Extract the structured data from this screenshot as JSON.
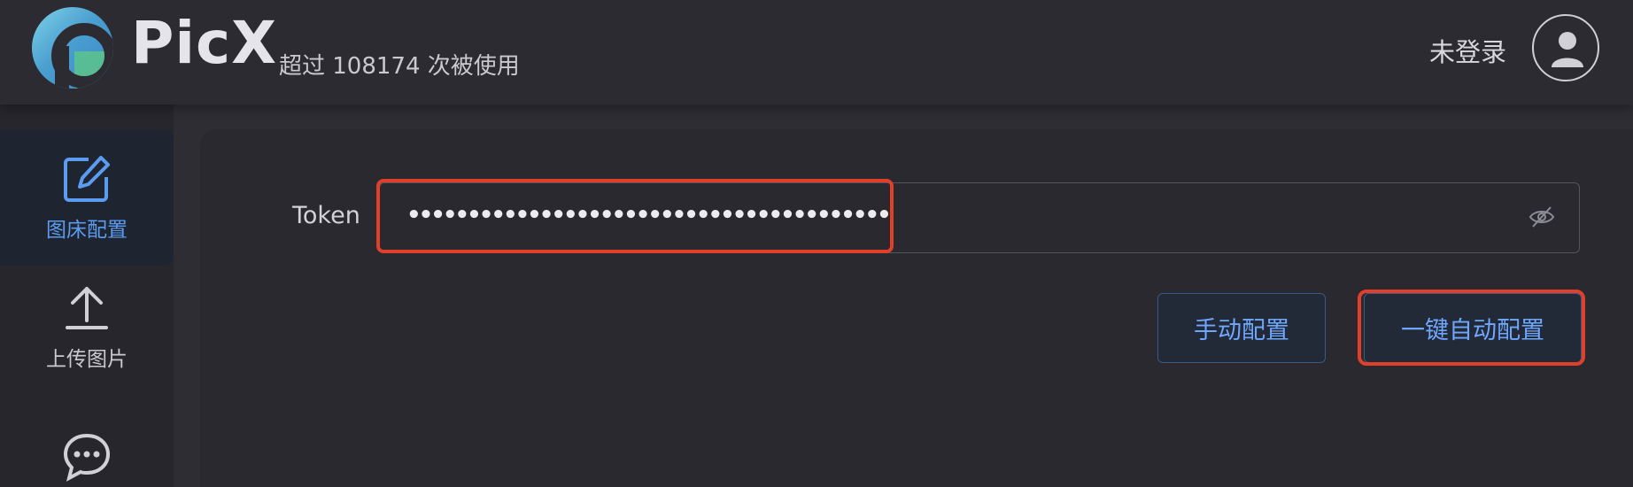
{
  "header": {
    "brand": "PicX",
    "usage_text": "超过 108174 次被使用",
    "login_status": "未登录"
  },
  "sidebar": {
    "items": [
      {
        "label": "图床配置",
        "icon": "edit-icon",
        "active": true
      },
      {
        "label": "上传图片",
        "icon": "upload-icon",
        "active": false
      },
      {
        "label": "",
        "icon": "chat-icon",
        "active": false
      }
    ]
  },
  "form": {
    "token_label": "Token",
    "token_value": "••••••••••••••••••••••••••••••••••••••••"
  },
  "buttons": {
    "manual": "手动配置",
    "auto": "一键自动配置"
  },
  "colors": {
    "accent": "#6fa6ff",
    "highlight": "#e0402a",
    "background": "#2d2d33"
  }
}
